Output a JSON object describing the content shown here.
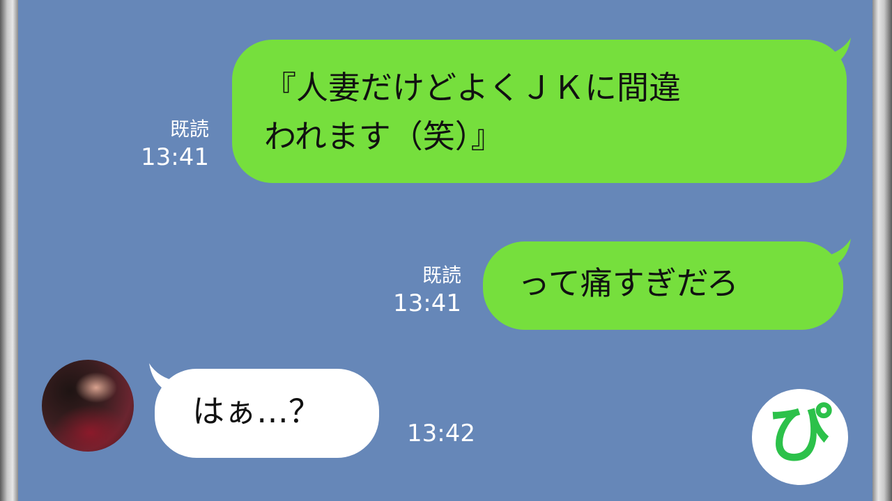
{
  "messages": [
    {
      "direction": "sent",
      "text_line1": "『人妻だけどよくＪＫに間違",
      "text_line2": "われます（笑）』",
      "read": "既読",
      "time": "13:41"
    },
    {
      "direction": "sent",
      "text": "って痛すぎだろ",
      "read": "既読",
      "time": "13:41"
    },
    {
      "direction": "received",
      "text": "はぁ…？",
      "time": "13:42"
    }
  ],
  "logo": {
    "text": "ぴ"
  },
  "colors": {
    "background": "#6687b8",
    "sent_bubble": "#76df3d",
    "received_bubble": "#ffffff",
    "logo_green": "#2cc14a"
  }
}
